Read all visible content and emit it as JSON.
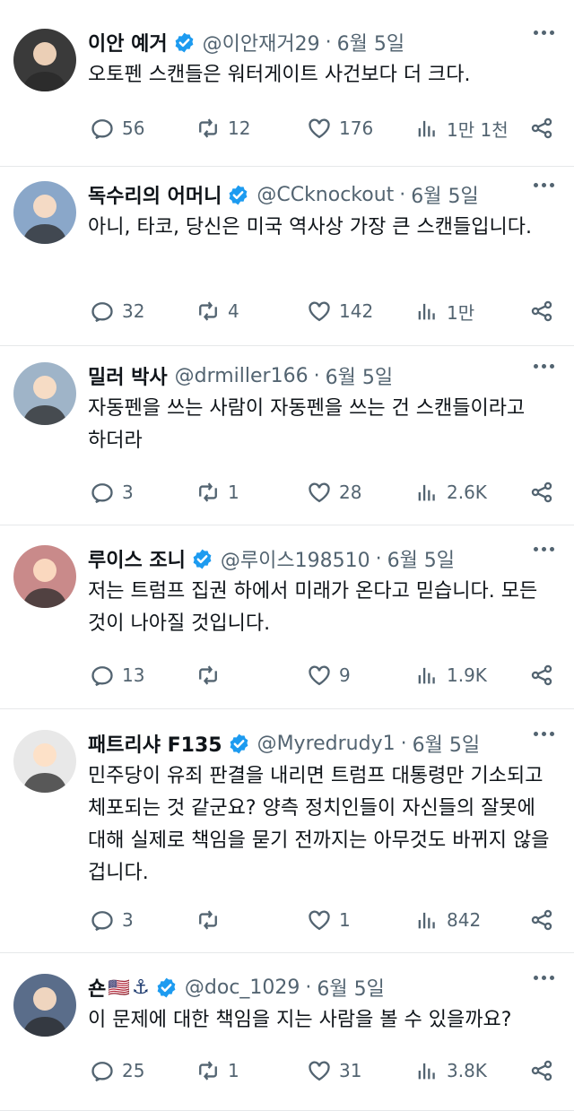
{
  "tweets": [
    {
      "name": "이안 예거",
      "verified": true,
      "flag": "",
      "anchor": "",
      "handle": "@이안재거29",
      "time": "6월 5일",
      "text": "오토펜 스캔들은 워터게이트 사건보다 더 크다.",
      "replies": "56",
      "retweets": "12",
      "likes": "176",
      "views": "1만 1천",
      "avatar_color": "#3a3a3a"
    },
    {
      "name": "독수리의 어머니",
      "verified": true,
      "flag": "",
      "anchor": "",
      "handle": "@CCknockout",
      "time": "6월 5일",
      "text": "아니, 타코, 당신은 미국 역사상 가장 큰 스캔들입니다.",
      "replies": "32",
      "retweets": "4",
      "likes": "142",
      "views": "1만",
      "avatar_color": "#8aa7c9"
    },
    {
      "name": "밀러 박사",
      "verified": false,
      "flag": "",
      "anchor": "",
      "handle": "@drmiller166",
      "time": "6월 5일",
      "text": "자동펜을 쓰는 사람이 자동펜을 쓰는 건 스캔들이라고 하더라",
      "replies": "3",
      "retweets": "1",
      "likes": "28",
      "views": "2.6K",
      "avatar_color": "#9fb4c8"
    },
    {
      "name": "루이스 조니",
      "verified": true,
      "flag": "",
      "anchor": "",
      "handle": "@루이스198510",
      "time": "6월 5일",
      "text": "저는 트럼프 집권 하에서 미래가 온다고 믿습니다. 모든 것이 나아질 것입니다.",
      "replies": "13",
      "retweets": "",
      "likes": "9",
      "views": "1.9K",
      "avatar_color": "#c98a8a"
    },
    {
      "name": "패트리샤 F135",
      "verified": true,
      "flag": "",
      "anchor": "",
      "handle": "@Myredrudy1",
      "time": "6월 5일",
      "text": "민주당이 유죄 판결을 내리면 트럼프 대통령만 기소되고 체포되는 것 같군요? 양측 정치인들이 자신들의 잘못에 대해 실제로 책임을 묻기 전까지는 아무것도 바뀌지 않을 겁니다.",
      "replies": "3",
      "retweets": "",
      "likes": "1",
      "views": "842",
      "avatar_color": "#e8e8e8"
    },
    {
      "name": "숀",
      "verified": true,
      "flag": "🇺🇸",
      "anchor": "⚓",
      "handle": "@doc_1029",
      "time": "6월 5일",
      "text": "이 문제에 대한 책임을 지는 사람을 볼 수 있을까요?",
      "replies": "25",
      "retweets": "1",
      "likes": "31",
      "views": "3.8K",
      "avatar_color": "#5a6d8a"
    }
  ],
  "accent": "#1d9bf0",
  "muted": "#536471",
  "icons": {
    "reply": "reply-icon",
    "retweet": "retweet-icon",
    "like": "like-icon",
    "views": "views-icon",
    "share": "share-icon",
    "more": "more-icon",
    "verified": "verified-badge-icon"
  }
}
